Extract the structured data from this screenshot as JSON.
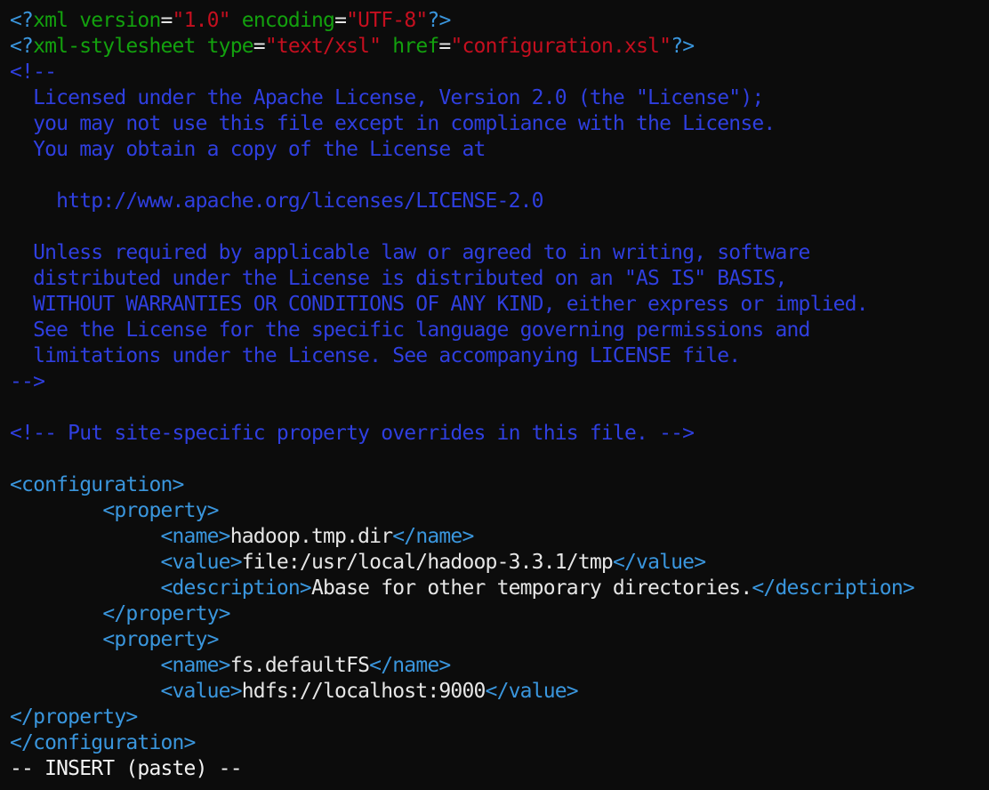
{
  "editor": {
    "mode": "-- INSERT (paste) --",
    "lines": [
      [
        [
          "<?",
          "cyan"
        ],
        [
          "xml version",
          "green"
        ],
        [
          "=",
          "white"
        ],
        [
          "\"1.0\"",
          "red"
        ],
        [
          " ",
          "white"
        ],
        [
          "encoding",
          "green"
        ],
        [
          "=",
          "white"
        ],
        [
          "\"UTF-8\"",
          "red"
        ],
        [
          "?>",
          "cyan"
        ]
      ],
      [
        [
          "<?",
          "cyan"
        ],
        [
          "xml-stylesheet type",
          "green"
        ],
        [
          "=",
          "white"
        ],
        [
          "\"text/xsl\"",
          "red"
        ],
        [
          " ",
          "white"
        ],
        [
          "href",
          "green"
        ],
        [
          "=",
          "white"
        ],
        [
          "\"configuration.xsl\"",
          "red"
        ],
        [
          "?>",
          "cyan"
        ]
      ],
      [
        [
          "<!--",
          "blue"
        ]
      ],
      [
        [
          "  Licensed under the Apache License, Version 2.0 (the \"License\");",
          "blue"
        ]
      ],
      [
        [
          "  you may not use this file except in compliance with the License.",
          "blue"
        ]
      ],
      [
        [
          "  You may obtain a copy of the License at",
          "blue"
        ]
      ],
      [
        [
          "",
          "blue"
        ]
      ],
      [
        [
          "    http://www.apache.org/licenses/LICENSE-2.0",
          "blue"
        ]
      ],
      [
        [
          "",
          "blue"
        ]
      ],
      [
        [
          "  Unless required by applicable law or agreed to in writing, software",
          "blue"
        ]
      ],
      [
        [
          "  distributed under the License is distributed on an \"AS IS\" BASIS,",
          "blue"
        ]
      ],
      [
        [
          "  WITHOUT WARRANTIES OR CONDITIONS OF ANY KIND, either express or implied.",
          "blue"
        ]
      ],
      [
        [
          "  See the License for the specific language governing permissions and",
          "blue"
        ]
      ],
      [
        [
          "  limitations under the License. See accompanying LICENSE file.",
          "blue"
        ]
      ],
      [
        [
          "-->",
          "blue"
        ]
      ],
      [
        [
          "",
          "white"
        ]
      ],
      [
        [
          "<!-- Put site-specific property overrides in this file. -->",
          "blue"
        ]
      ],
      [
        [
          "",
          "white"
        ]
      ],
      [
        [
          "<configuration>",
          "cyan"
        ]
      ],
      [
        [
          "        ",
          "white"
        ],
        [
          "<property>",
          "cyan"
        ]
      ],
      [
        [
          "             ",
          "white"
        ],
        [
          "<name>",
          "cyan"
        ],
        [
          "hadoop.tmp.dir",
          "white"
        ],
        [
          "</name>",
          "cyan"
        ]
      ],
      [
        [
          "             ",
          "white"
        ],
        [
          "<value>",
          "cyan"
        ],
        [
          "file:/usr/local/hadoop-3.3.1/tmp",
          "white"
        ],
        [
          "</value>",
          "cyan"
        ]
      ],
      [
        [
          "             ",
          "white"
        ],
        [
          "<description>",
          "cyan"
        ],
        [
          "Abase for other temporary directories.",
          "white"
        ],
        [
          "</description>",
          "cyan"
        ]
      ],
      [
        [
          "        ",
          "white"
        ],
        [
          "</property>",
          "cyan"
        ]
      ],
      [
        [
          "        ",
          "white"
        ],
        [
          "<property>",
          "cyan"
        ]
      ],
      [
        [
          "             ",
          "white"
        ],
        [
          "<name>",
          "cyan"
        ],
        [
          "fs.defaultFS",
          "white"
        ],
        [
          "</name>",
          "cyan"
        ]
      ],
      [
        [
          "             ",
          "white"
        ],
        [
          "<value>",
          "cyan"
        ],
        [
          "hdfs://localhost:9000",
          "white"
        ],
        [
          "</value>",
          "cyan"
        ]
      ],
      [
        [
          "</property>",
          "cyan"
        ]
      ],
      [
        [
          "</configuration>",
          "cyan"
        ]
      ]
    ]
  }
}
